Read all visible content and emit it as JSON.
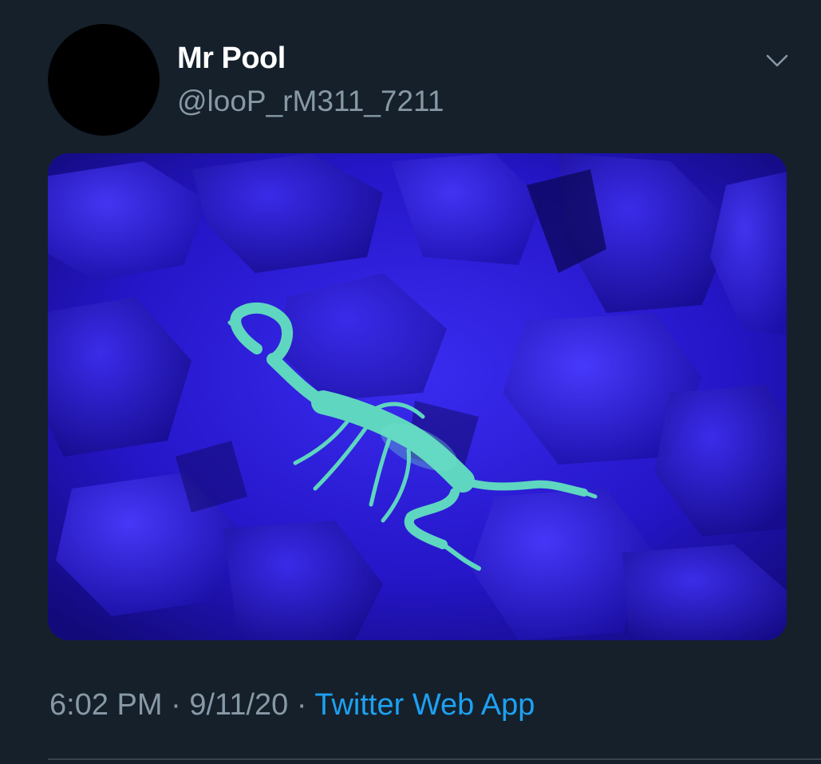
{
  "tweet": {
    "display_name": "Mr Pool",
    "handle": "@looP_rM311_7211",
    "time": "6:02 PM",
    "date": "9/11/20",
    "separator": " · ",
    "source": "Twitter Web App"
  },
  "icons": {
    "caret": "chevron-down-icon"
  },
  "colors": {
    "background": "#15202b",
    "text_primary": "#ffffff",
    "text_secondary": "#8899a6",
    "link": "#1da1f2",
    "photo_uv": "#2a18d8",
    "scorpion": "#5fd6c0"
  }
}
